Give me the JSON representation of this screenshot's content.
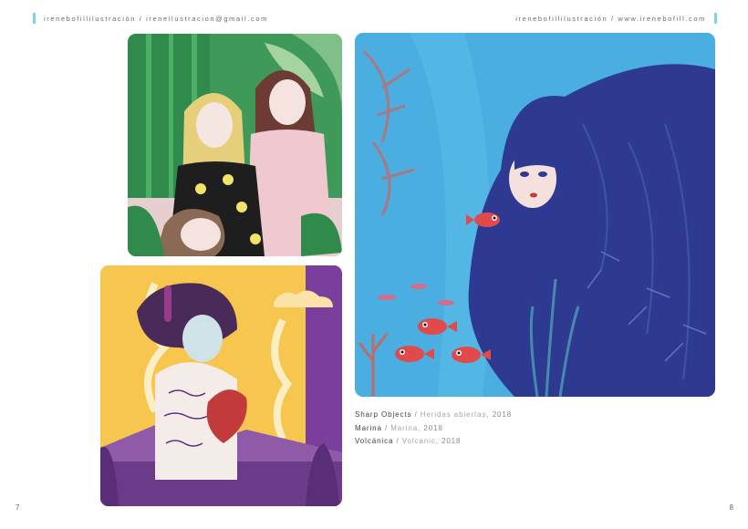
{
  "header": {
    "left": "irenebofillilustración / ireneilustracion@gmail.com",
    "right": "irenebofillilustración / www.irenebofill.com"
  },
  "captions": [
    {
      "title": "Sharp Objects",
      "sep": "/",
      "subtitle": "Heridas abiertas,",
      "year": "2018"
    },
    {
      "title": "Marina",
      "sep": "/",
      "subtitle": "Marina,",
      "year": "2018"
    },
    {
      "title": "Volcánica",
      "sep": "/",
      "subtitle": "Volcanic,",
      "year": "2018"
    }
  ],
  "pages": {
    "left": "7",
    "right": "8"
  },
  "colors": {
    "accent_bar": "#7fd3e6",
    "sea_blue": "#4aaee0",
    "hair_navy": "#2e3a92",
    "volcanic_yellow": "#f7c64f",
    "volcanic_purple": "#7a3f9c",
    "jungle_green": "#3f9a5a"
  }
}
